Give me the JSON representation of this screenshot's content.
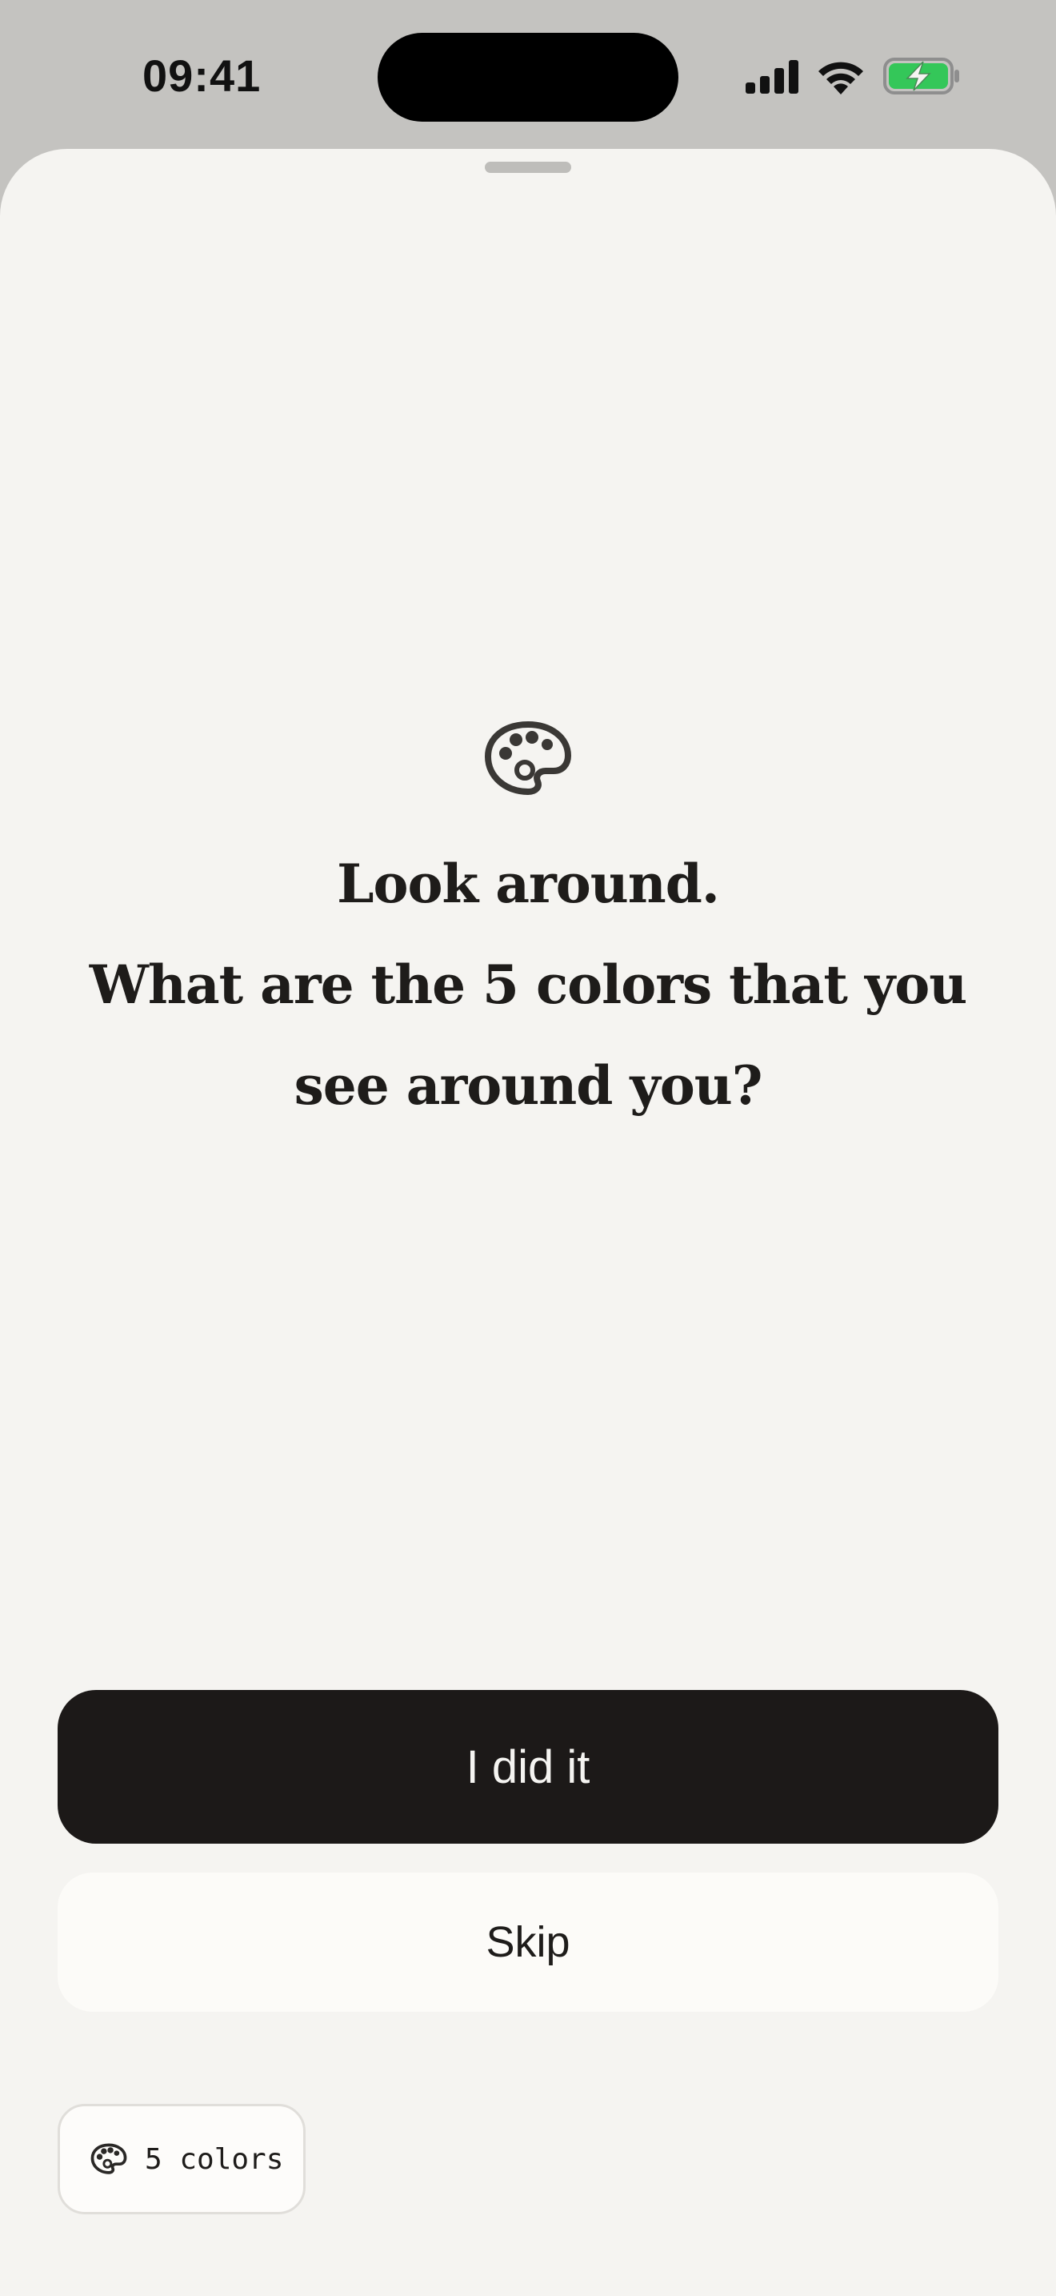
{
  "status_bar": {
    "time": "09:41",
    "icons": [
      "cellular-signal-icon",
      "wifi-icon",
      "battery-charging-icon"
    ]
  },
  "prompt": {
    "icon": "palette-icon",
    "line1": "Look around.",
    "line2": "What are the 5 colors that you",
    "line3": "see around you?"
  },
  "actions": {
    "primary_label": "I did it",
    "secondary_label": "Skip"
  },
  "chip": {
    "icon": "palette-icon",
    "label": "5 colors"
  },
  "colors": {
    "background": "#F5F4F1",
    "primary_button": "#1C1918",
    "battery_green": "#34C759"
  }
}
